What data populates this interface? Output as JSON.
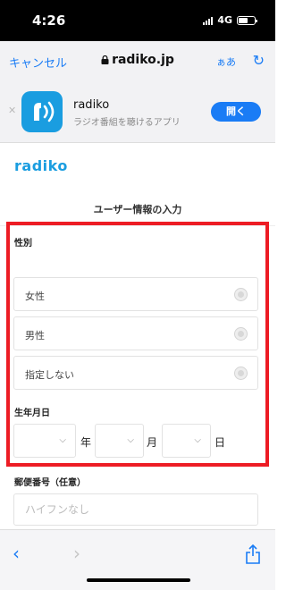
{
  "status_bar": {
    "time": "4:26",
    "network": "4G"
  },
  "browser": {
    "cancel_label": "キャンセル",
    "url": "radiko.jp",
    "text_size_label": "ぁあ"
  },
  "app_banner": {
    "app_name": "radiko",
    "subtitle": "ラジオ番組を聴けるアプリ",
    "open_label": "開く"
  },
  "page": {
    "logo": "radiko",
    "title": "ユーザー情報の入力",
    "gender": {
      "label": "性別",
      "options": [
        "女性",
        "男性",
        "指定しない"
      ]
    },
    "birthdate": {
      "label": "生年月日",
      "year_suffix": "年",
      "month_suffix": "月",
      "day_suffix": "日",
      "year_value": "",
      "month_value": "",
      "day_value": ""
    },
    "postal": {
      "label": "郵便番号（任意）",
      "placeholder": "ハイフンなし",
      "value": ""
    }
  },
  "colors": {
    "accent": "#1a7cf5",
    "brand": "#1a9de0",
    "highlight": "#ed1c24"
  },
  "icons": [
    "lock-icon",
    "reload-icon",
    "close-icon",
    "radiko-app-icon",
    "chevron-down-icon",
    "back-icon",
    "forward-icon",
    "share-icon"
  ]
}
